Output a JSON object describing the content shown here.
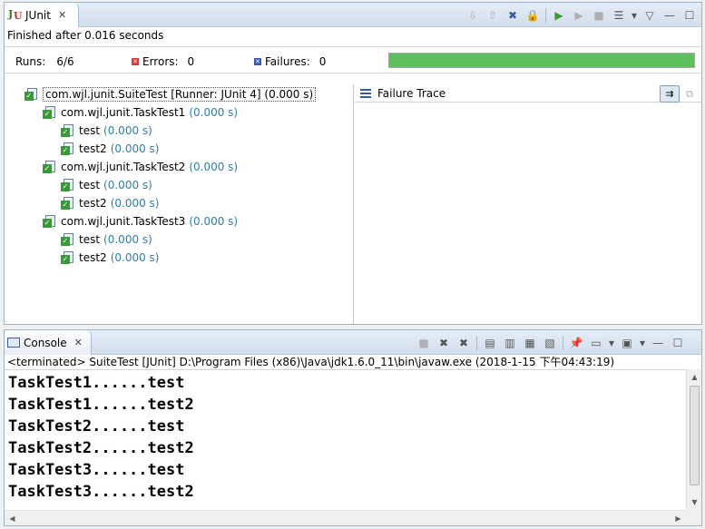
{
  "junit": {
    "tab_label": "JUnit",
    "close_glyph": "✕",
    "status": "Finished after 0.016 seconds",
    "runs_label": "Runs:",
    "runs_value": "6/6",
    "errors_label": "Errors:",
    "errors_value": "0",
    "failures_label": "Failures:",
    "failures_value": "0",
    "progress_fraction": 1.0,
    "progress_color": "#5fbf5f",
    "failure_trace_label": "Failure Trace",
    "tree": [
      {
        "label": "com.wjl.junit.SuiteTest [Runner: JUnit 4] (0.000 s)",
        "time": "",
        "level": 0
      },
      {
        "label": "com.wjl.junit.TaskTest1",
        "time": "(0.000 s)",
        "level": 1
      },
      {
        "label": "test",
        "time": "(0.000 s)",
        "level": 2
      },
      {
        "label": "test2",
        "time": "(0.000 s)",
        "level": 2
      },
      {
        "label": "com.wjl.junit.TaskTest2",
        "time": "(0.000 s)",
        "level": 1
      },
      {
        "label": "test",
        "time": "(0.000 s)",
        "level": 2
      },
      {
        "label": "test2",
        "time": "(0.000 s)",
        "level": 2
      },
      {
        "label": "com.wjl.junit.TaskTest3",
        "time": "(0.000 s)",
        "level": 1
      },
      {
        "label": "test",
        "time": "(0.000 s)",
        "level": 2
      },
      {
        "label": "test2",
        "time": "(0.000 s)",
        "level": 2
      }
    ]
  },
  "console": {
    "tab_label": "Console",
    "close_glyph": "✕",
    "terminated_line": "<terminated> SuiteTest [JUnit] D:\\Program Files (x86)\\Java\\jdk1.6.0_11\\bin\\javaw.exe (2018-1-15 下午04:43:19)",
    "output": [
      "TaskTest1......test",
      "TaskTest1......test2",
      "TaskTest2......test",
      "TaskTest2......test2",
      "TaskTest3......test",
      "TaskTest3......test2"
    ]
  },
  "icons": {
    "next-failure": "⇩",
    "prev-failure": "⇧",
    "show-failures-only": "✖",
    "scroll-lock": "🔒",
    "rerun": "▶",
    "rerun-failed": "▶",
    "stop": "■",
    "history": "☰",
    "dropdown": "▾",
    "view-menu": "▽",
    "minimize": "—",
    "maximize": "☐",
    "terminate": "■",
    "remove-launch": "✖",
    "remove-all": "✖",
    "clear": "▤",
    "scroll-lock-console": "▥",
    "word-wrap": "▦",
    "show-when-changed": "▧",
    "pin": "📌",
    "display-console": "▭",
    "new-console": "▣"
  }
}
